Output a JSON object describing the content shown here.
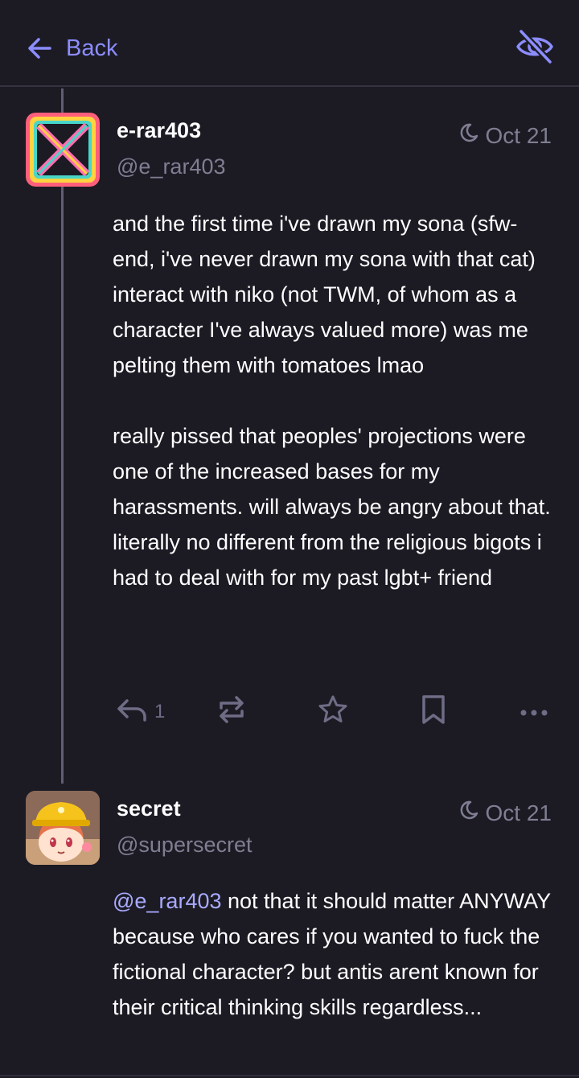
{
  "header": {
    "back_label": "Back",
    "back_icon": "arrow-left-icon",
    "hide_icon": "eye-slash-icon"
  },
  "posts": [
    {
      "display_name": "e-rar403",
      "handle": "@e_rar403",
      "timestamp": "Oct 21",
      "timestamp_icon": "moon-icon",
      "avatar": "pixel-x-avatar",
      "content": "and the first time i've drawn my sona (sfw-end, i've never drawn my sona with that cat) interact with niko (not TWM, of whom as a character I've always valued more) was me pelting them with tomatoes lmao\n\nreally pissed that peoples' projections were one of the increased bases for my harassments. will always be angry about that. literally no different from the religious bigots i had to deal with for my past lgbt+ friend",
      "reply_count": "1",
      "actions": [
        "reply-icon",
        "boost-icon",
        "favourite-icon",
        "bookmark-icon",
        "more-icon"
      ]
    },
    {
      "display_name": "secret",
      "handle": "@supersecret",
      "timestamp": "Oct 21",
      "timestamp_icon": "moon-icon",
      "avatar": "cartoon-character-avatar",
      "mention": "@e_rar403",
      "content": " not that it should matter ANYWAY because who cares if you wanted to fuck the fictional character? but antis arent known for their critical thinking skills regardless..."
    }
  ],
  "colors": {
    "background": "#1c1b24",
    "accent": "#8c8dff",
    "muted": "#7f7e92",
    "thread_line": "#5f5e73"
  }
}
